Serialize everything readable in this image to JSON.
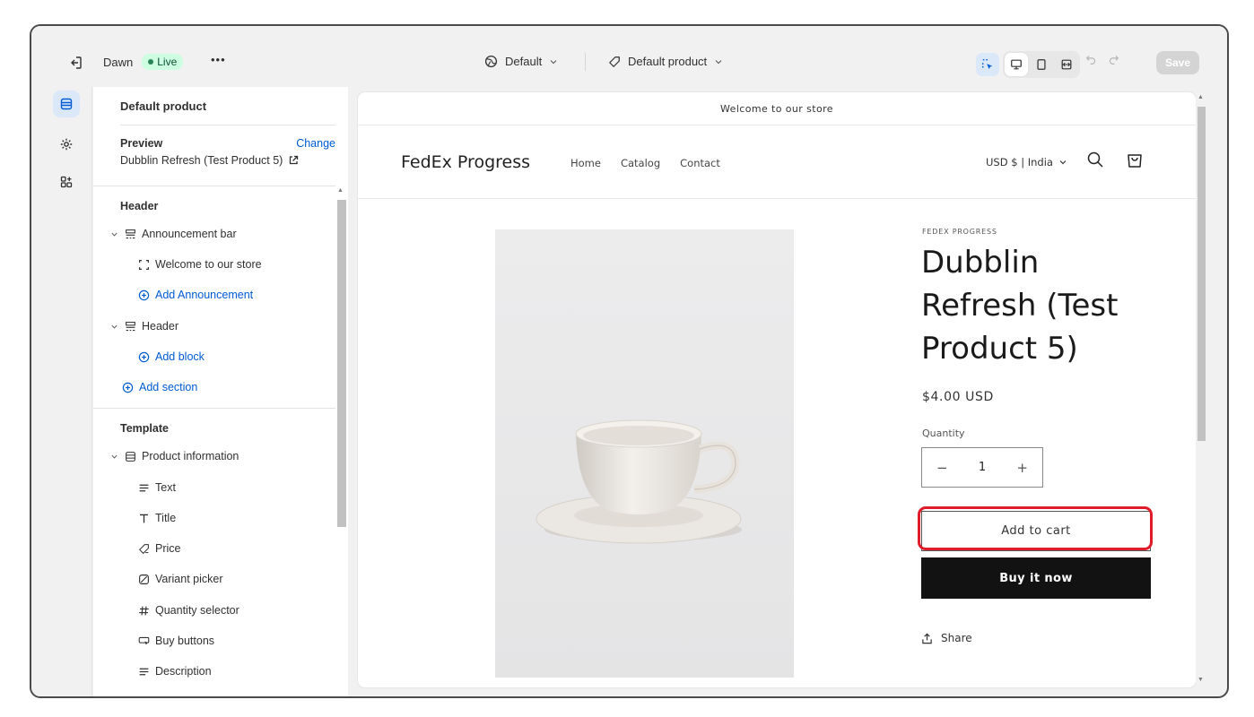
{
  "topbar": {
    "theme_name": "Dawn",
    "live_badge": "Live",
    "more": "•••",
    "market_label": "Default",
    "template_label": "Default product",
    "save_label": "Save"
  },
  "sidebar": {
    "title": "Default product",
    "preview_label": "Preview",
    "change_label": "Change",
    "preview_value": "Dubblin Refresh (Test Product 5)",
    "header_group": "Header",
    "header_items": [
      {
        "label": "Announcement bar"
      },
      {
        "label": "Welcome to our store"
      },
      {
        "label": "Add Announcement"
      },
      {
        "label": "Header"
      },
      {
        "label": "Add block"
      },
      {
        "label": "Add section"
      }
    ],
    "template_group": "Template",
    "template_items": [
      {
        "label": "Product information"
      },
      {
        "label": "Text"
      },
      {
        "label": "Title"
      },
      {
        "label": "Price"
      },
      {
        "label": "Variant picker"
      },
      {
        "label": "Quantity selector"
      },
      {
        "label": "Buy buttons"
      },
      {
        "label": "Description"
      }
    ]
  },
  "store": {
    "announcement": "Welcome to our store",
    "name": "FedEx Progress",
    "nav": [
      "Home",
      "Catalog",
      "Contact"
    ],
    "currency": "USD $ | India",
    "product": {
      "vendor": "FEDEX PROGRESS",
      "title": "Dubblin Refresh (Test Product 5)",
      "price": "$4.00 USD",
      "quantity_label": "Quantity",
      "quantity": "1",
      "minus": "−",
      "plus": "+",
      "add_to_cart": "Add to cart",
      "buy_now": "Buy it now",
      "share": "Share"
    }
  },
  "colors": {
    "accent_blue": "#005bd3",
    "live_green": "#29845a",
    "highlight_red": "#e01b2a",
    "buy_button": "#121212"
  }
}
